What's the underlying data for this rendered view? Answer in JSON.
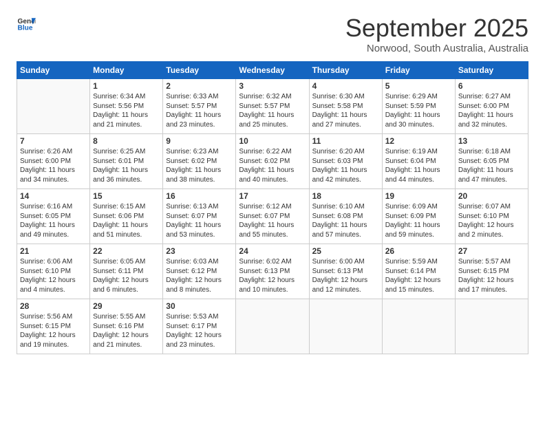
{
  "header": {
    "logo_line1": "General",
    "logo_line2": "Blue",
    "month_title": "September 2025",
    "location": "Norwood, South Australia, Australia"
  },
  "weekdays": [
    "Sunday",
    "Monday",
    "Tuesday",
    "Wednesday",
    "Thursday",
    "Friday",
    "Saturday"
  ],
  "weeks": [
    [
      {
        "day": "",
        "info": ""
      },
      {
        "day": "1",
        "info": "Sunrise: 6:34 AM\nSunset: 5:56 PM\nDaylight: 11 hours\nand 21 minutes."
      },
      {
        "day": "2",
        "info": "Sunrise: 6:33 AM\nSunset: 5:57 PM\nDaylight: 11 hours\nand 23 minutes."
      },
      {
        "day": "3",
        "info": "Sunrise: 6:32 AM\nSunset: 5:57 PM\nDaylight: 11 hours\nand 25 minutes."
      },
      {
        "day": "4",
        "info": "Sunrise: 6:30 AM\nSunset: 5:58 PM\nDaylight: 11 hours\nand 27 minutes."
      },
      {
        "day": "5",
        "info": "Sunrise: 6:29 AM\nSunset: 5:59 PM\nDaylight: 11 hours\nand 30 minutes."
      },
      {
        "day": "6",
        "info": "Sunrise: 6:27 AM\nSunset: 6:00 PM\nDaylight: 11 hours\nand 32 minutes."
      }
    ],
    [
      {
        "day": "7",
        "info": "Sunrise: 6:26 AM\nSunset: 6:00 PM\nDaylight: 11 hours\nand 34 minutes."
      },
      {
        "day": "8",
        "info": "Sunrise: 6:25 AM\nSunset: 6:01 PM\nDaylight: 11 hours\nand 36 minutes."
      },
      {
        "day": "9",
        "info": "Sunrise: 6:23 AM\nSunset: 6:02 PM\nDaylight: 11 hours\nand 38 minutes."
      },
      {
        "day": "10",
        "info": "Sunrise: 6:22 AM\nSunset: 6:02 PM\nDaylight: 11 hours\nand 40 minutes."
      },
      {
        "day": "11",
        "info": "Sunrise: 6:20 AM\nSunset: 6:03 PM\nDaylight: 11 hours\nand 42 minutes."
      },
      {
        "day": "12",
        "info": "Sunrise: 6:19 AM\nSunset: 6:04 PM\nDaylight: 11 hours\nand 44 minutes."
      },
      {
        "day": "13",
        "info": "Sunrise: 6:18 AM\nSunset: 6:05 PM\nDaylight: 11 hours\nand 47 minutes."
      }
    ],
    [
      {
        "day": "14",
        "info": "Sunrise: 6:16 AM\nSunset: 6:05 PM\nDaylight: 11 hours\nand 49 minutes."
      },
      {
        "day": "15",
        "info": "Sunrise: 6:15 AM\nSunset: 6:06 PM\nDaylight: 11 hours\nand 51 minutes."
      },
      {
        "day": "16",
        "info": "Sunrise: 6:13 AM\nSunset: 6:07 PM\nDaylight: 11 hours\nand 53 minutes."
      },
      {
        "day": "17",
        "info": "Sunrise: 6:12 AM\nSunset: 6:07 PM\nDaylight: 11 hours\nand 55 minutes."
      },
      {
        "day": "18",
        "info": "Sunrise: 6:10 AM\nSunset: 6:08 PM\nDaylight: 11 hours\nand 57 minutes."
      },
      {
        "day": "19",
        "info": "Sunrise: 6:09 AM\nSunset: 6:09 PM\nDaylight: 11 hours\nand 59 minutes."
      },
      {
        "day": "20",
        "info": "Sunrise: 6:07 AM\nSunset: 6:10 PM\nDaylight: 12 hours\nand 2 minutes."
      }
    ],
    [
      {
        "day": "21",
        "info": "Sunrise: 6:06 AM\nSunset: 6:10 PM\nDaylight: 12 hours\nand 4 minutes."
      },
      {
        "day": "22",
        "info": "Sunrise: 6:05 AM\nSunset: 6:11 PM\nDaylight: 12 hours\nand 6 minutes."
      },
      {
        "day": "23",
        "info": "Sunrise: 6:03 AM\nSunset: 6:12 PM\nDaylight: 12 hours\nand 8 minutes."
      },
      {
        "day": "24",
        "info": "Sunrise: 6:02 AM\nSunset: 6:13 PM\nDaylight: 12 hours\nand 10 minutes."
      },
      {
        "day": "25",
        "info": "Sunrise: 6:00 AM\nSunset: 6:13 PM\nDaylight: 12 hours\nand 12 minutes."
      },
      {
        "day": "26",
        "info": "Sunrise: 5:59 AM\nSunset: 6:14 PM\nDaylight: 12 hours\nand 15 minutes."
      },
      {
        "day": "27",
        "info": "Sunrise: 5:57 AM\nSunset: 6:15 PM\nDaylight: 12 hours\nand 17 minutes."
      }
    ],
    [
      {
        "day": "28",
        "info": "Sunrise: 5:56 AM\nSunset: 6:15 PM\nDaylight: 12 hours\nand 19 minutes."
      },
      {
        "day": "29",
        "info": "Sunrise: 5:55 AM\nSunset: 6:16 PM\nDaylight: 12 hours\nand 21 minutes."
      },
      {
        "day": "30",
        "info": "Sunrise: 5:53 AM\nSunset: 6:17 PM\nDaylight: 12 hours\nand 23 minutes."
      },
      {
        "day": "",
        "info": ""
      },
      {
        "day": "",
        "info": ""
      },
      {
        "day": "",
        "info": ""
      },
      {
        "day": "",
        "info": ""
      }
    ]
  ]
}
